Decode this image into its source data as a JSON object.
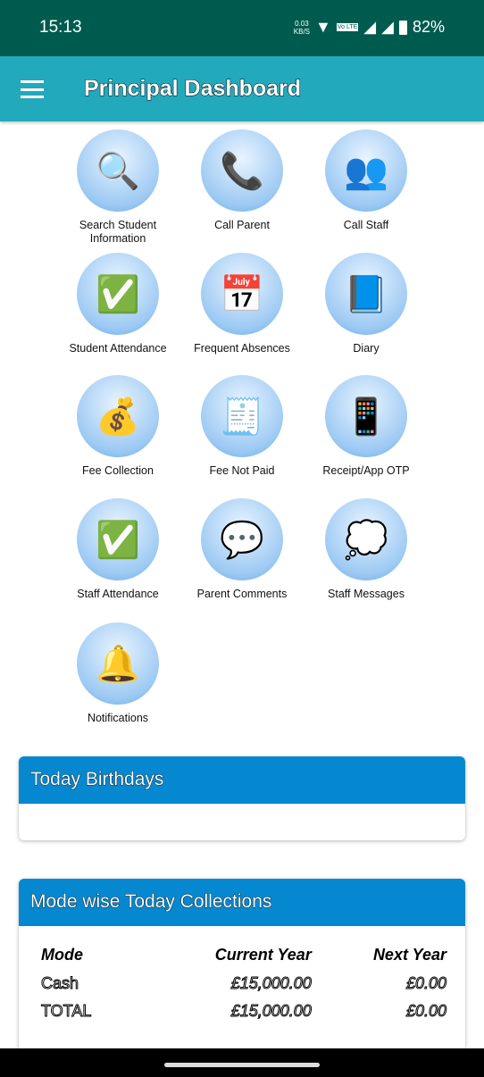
{
  "status_bar": {
    "time": "15:13",
    "net_speed": "0.03",
    "net_unit": "KB/S",
    "sim": "Vo LTE",
    "battery": "82%"
  },
  "app_bar": {
    "title": "Principal Dashboard"
  },
  "tiles": [
    {
      "label": "Search Student Information",
      "icon": "search-student-icon",
      "glyph": "🔍"
    },
    {
      "label": "Call Parent",
      "icon": "call-parent-icon",
      "glyph": "📞"
    },
    {
      "label": "Call Staff",
      "icon": "call-staff-icon",
      "glyph": "👥"
    },
    {
      "label": "Student Attendance",
      "icon": "student-attendance-icon",
      "glyph": "✅"
    },
    {
      "label": "Frequent Absences",
      "icon": "frequent-absences-icon",
      "glyph": "📅"
    },
    {
      "label": "Diary",
      "icon": "diary-icon",
      "glyph": "📘"
    },
    {
      "label": "Fee Collection",
      "icon": "fee-collection-icon",
      "glyph": "💰"
    },
    {
      "label": "Fee Not Paid",
      "icon": "fee-not-paid-icon",
      "glyph": "🧾"
    },
    {
      "label": "Receipt/App OTP",
      "icon": "otp-phone-icon",
      "glyph": "📱"
    },
    {
      "label": "Staff Attendance",
      "icon": "staff-attendance-icon",
      "glyph": "✅"
    },
    {
      "label": "Parent Comments",
      "icon": "parent-comments-icon",
      "glyph": "💬"
    },
    {
      "label": "Staff Messages",
      "icon": "staff-messages-icon",
      "glyph": "💭"
    },
    {
      "label": "Notifications",
      "icon": "bell-icon",
      "glyph": "🔔"
    }
  ],
  "birthdays": {
    "title": "Today Birthdays"
  },
  "collections": {
    "title": "Mode wise Today Collections",
    "headers": [
      "Mode",
      "Current Year",
      "Next Year"
    ],
    "rows": [
      [
        "Cash",
        "£15,000.00",
        "£0.00"
      ],
      [
        "TOTAL",
        "£15,000.00",
        "£0.00"
      ]
    ]
  }
}
